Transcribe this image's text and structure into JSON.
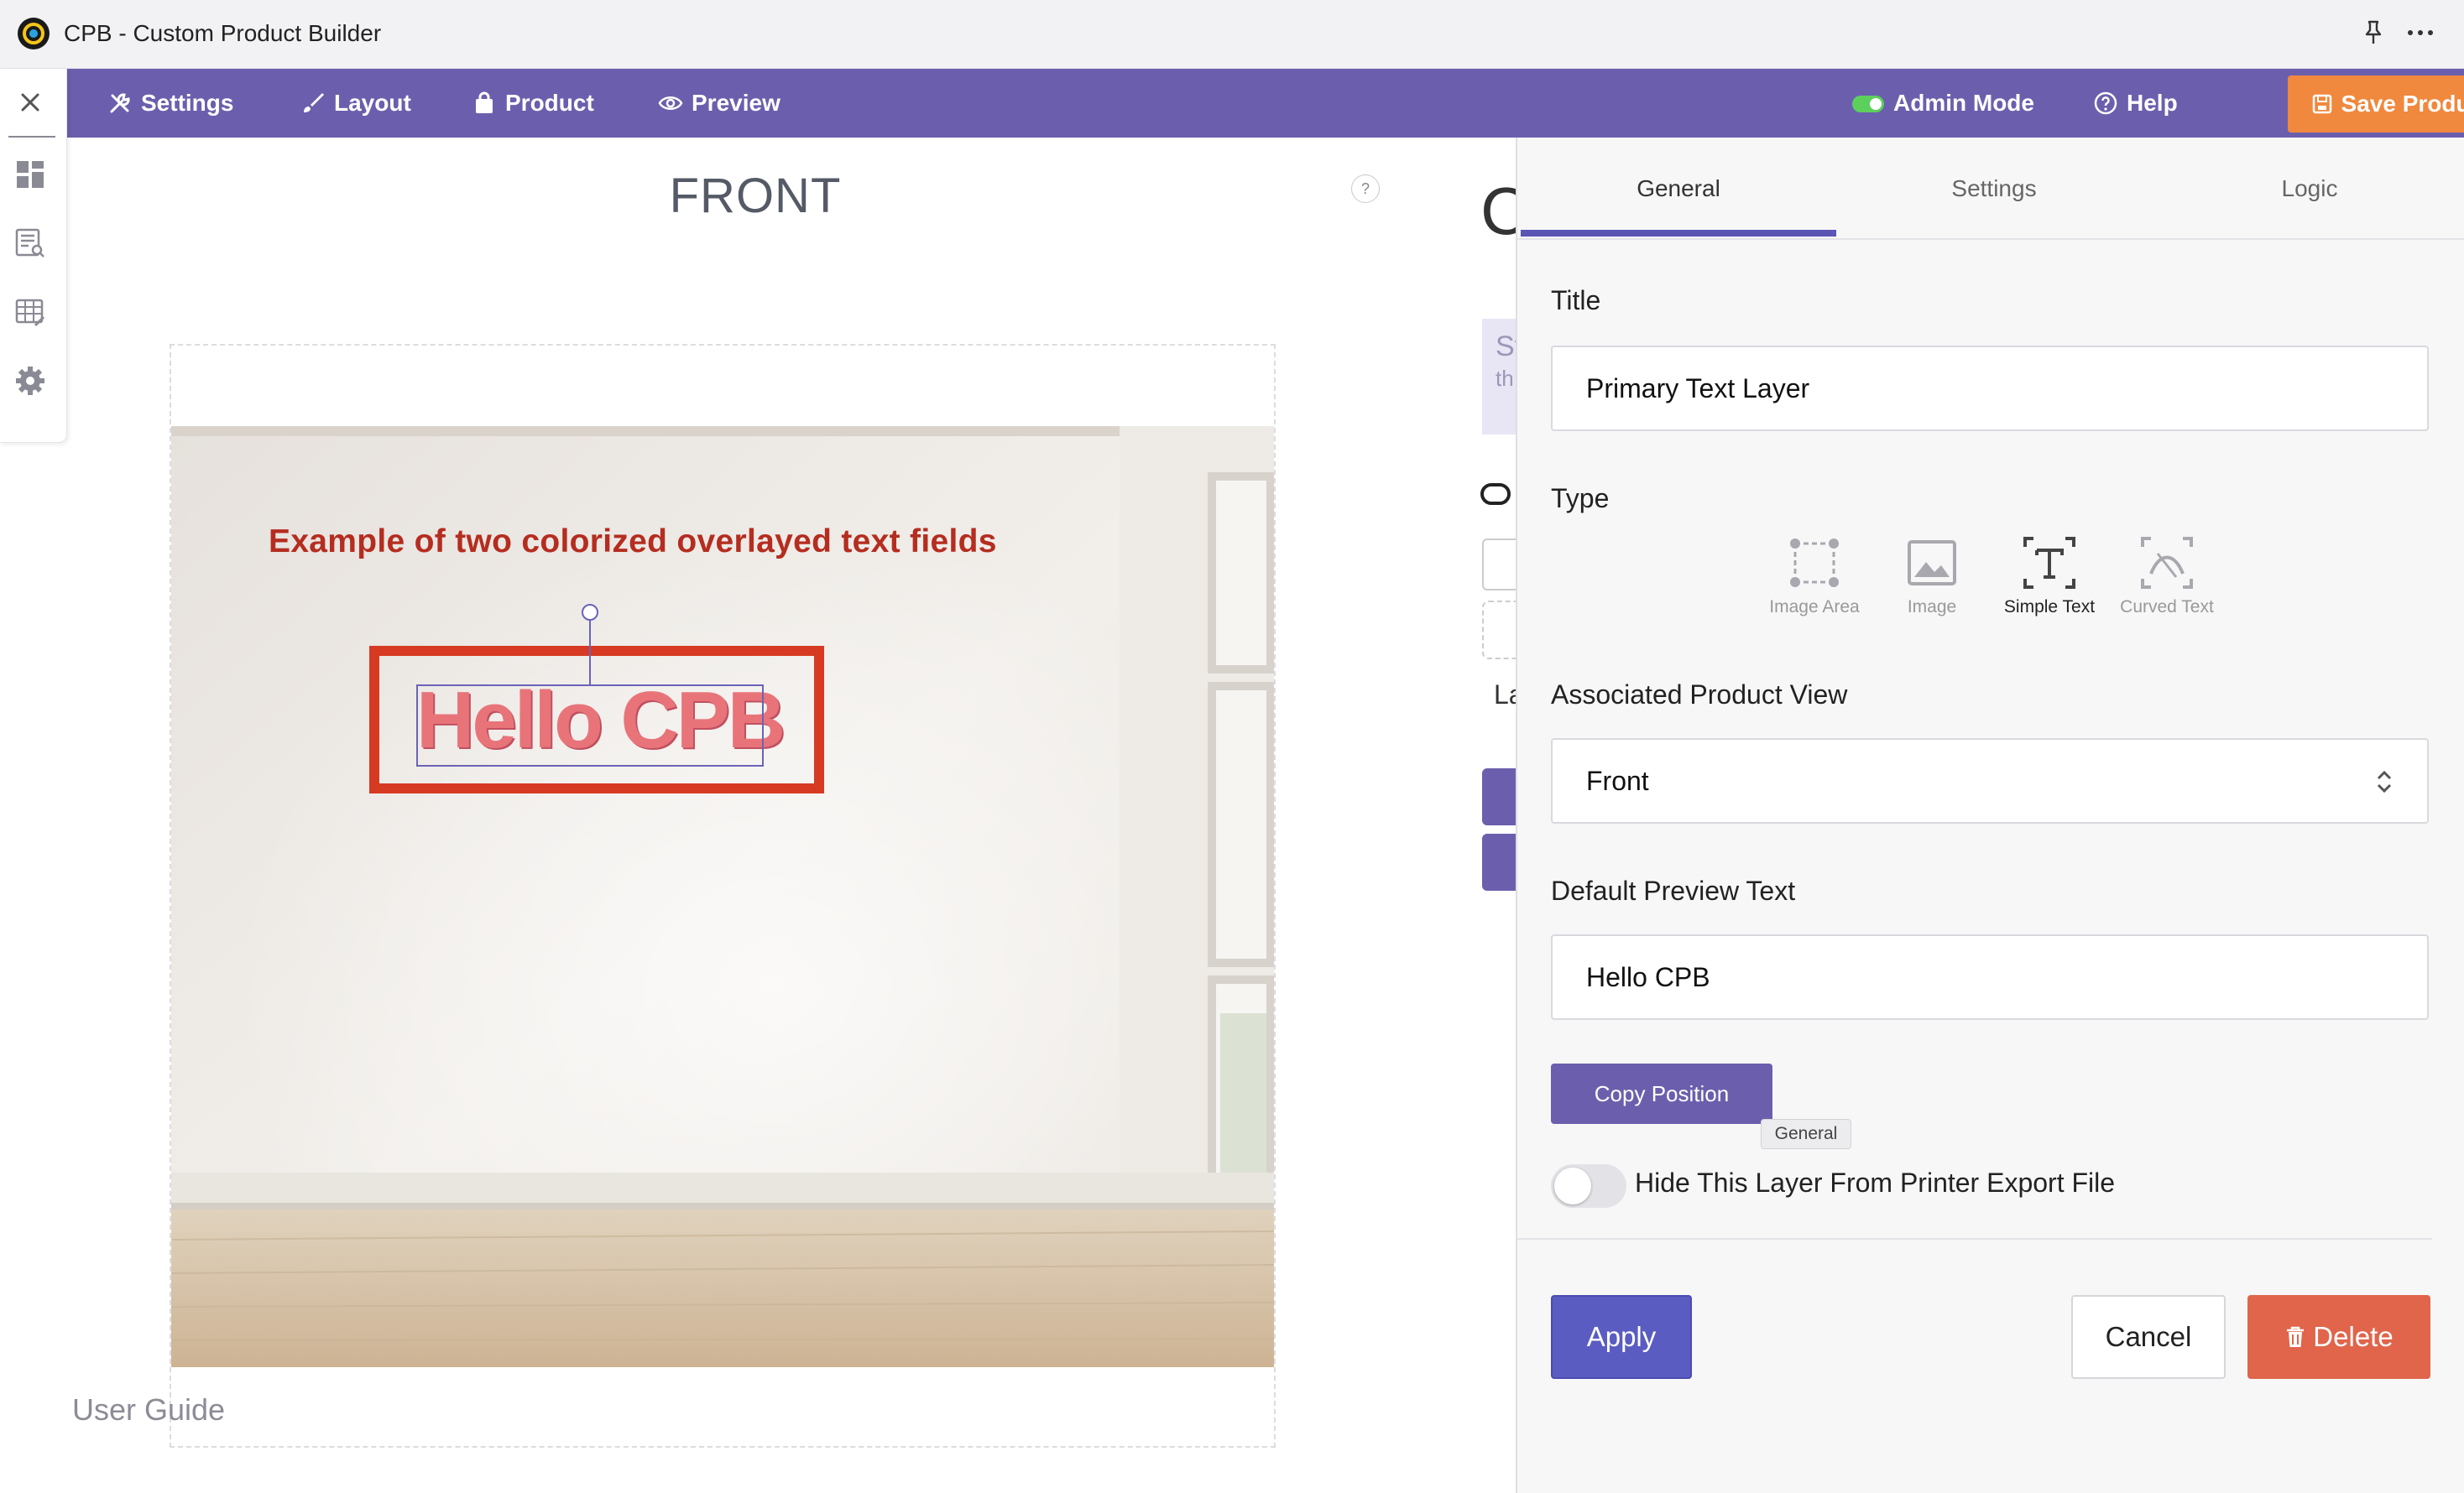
{
  "window": {
    "title": "CPB - Custom Product Builder"
  },
  "nav": {
    "settings": "Settings",
    "layout": "Layout",
    "product": "Product",
    "preview": "Preview",
    "admin_mode": "Admin Mode",
    "help": "Help",
    "save_product": "Save Product"
  },
  "canvas": {
    "view_label": "FRONT",
    "help_mark": "?",
    "caption": "Example of two colorized overlayed text fields",
    "sample_text": "Hello CPB",
    "user_guide": "User Guide"
  },
  "middle_fragments": {
    "big_letter": "C",
    "st": "St",
    "th": "th",
    "la": "La"
  },
  "panel": {
    "tabs": [
      {
        "label": "General",
        "active": true
      },
      {
        "label": "Settings",
        "active": false
      },
      {
        "label": "Logic",
        "active": false
      }
    ],
    "title_label": "Title",
    "title_value": "Primary Text Layer",
    "type_label": "Type",
    "type_options": [
      {
        "label": "Image Area",
        "icon": "image-area-icon",
        "active": false
      },
      {
        "label": "Image",
        "icon": "image-icon",
        "active": false
      },
      {
        "label": "Simple Text",
        "icon": "simple-text-icon",
        "active": true
      },
      {
        "label": "Curved Text",
        "icon": "curved-text-icon",
        "active": false
      }
    ],
    "view_label": "Associated Product View",
    "view_value": "Front",
    "preview_label": "Default Preview Text",
    "preview_value": "Hello CPB",
    "copy_position": "Copy Position",
    "tooltip": "General",
    "hide_label": "Hide This Layer From Printer Export File",
    "hide_enabled": false,
    "apply": "Apply",
    "cancel": "Cancel",
    "delete": "Delete"
  },
  "colors": {
    "nav": "#6b5fad",
    "save": "#f0883e",
    "apply": "#5a5cc2",
    "delete": "#e0654b",
    "caption": "#b52d20"
  }
}
